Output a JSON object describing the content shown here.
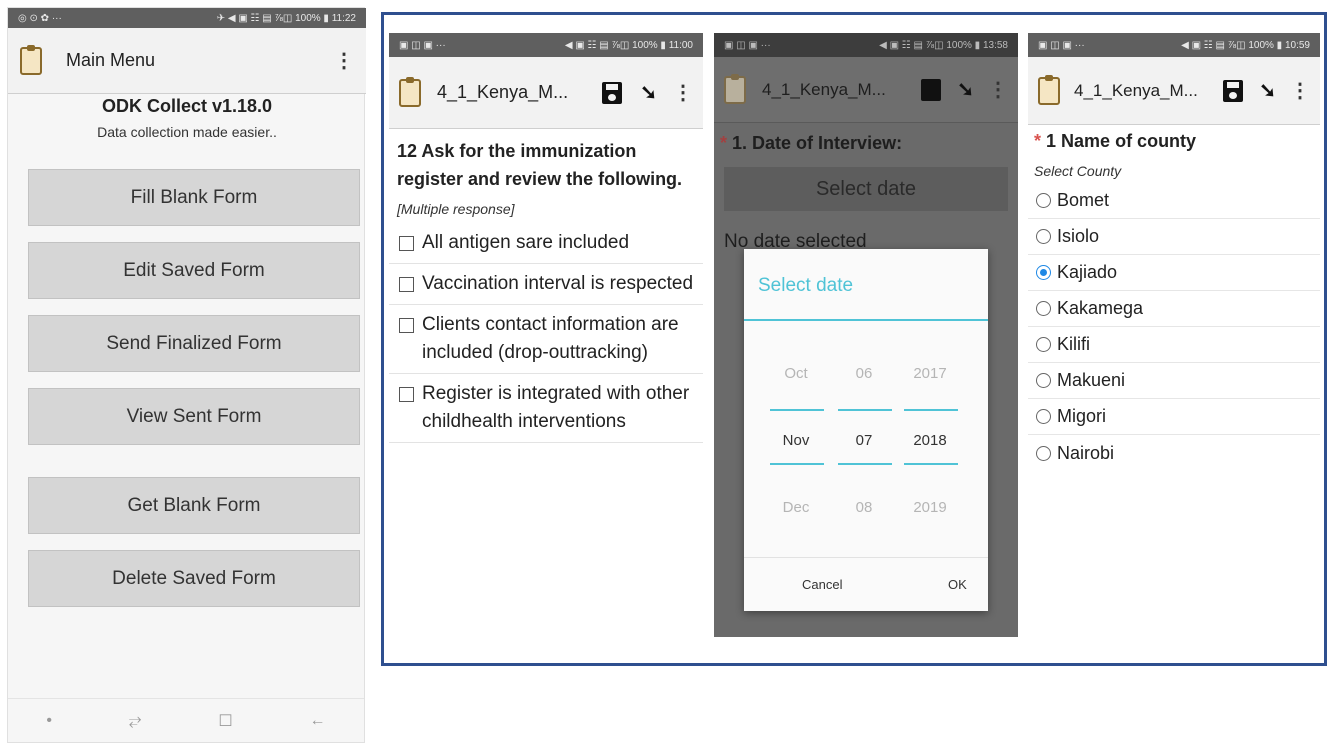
{
  "screen1": {
    "status_left": "◎ ⊙ ✿ ···",
    "status_right": "✈ ◀ ▣ ☷ ▤ ⅞◫ 100% ▮ 11:22",
    "title": "Main Menu",
    "app_name": "ODK Collect v1.18.0",
    "tagline": "Data collection made easier..",
    "buttons": [
      "Fill Blank Form",
      "Edit Saved Form",
      "Send Finalized Form",
      "View Sent Form",
      "Get Blank Form",
      "Delete Saved Form"
    ],
    "nav": {
      "dot": "•",
      "recent": "⥂",
      "home": "☐",
      "back": "←"
    }
  },
  "screen2": {
    "status_left": "▣ ◫ ▣ ···",
    "status_right": "◀ ▣ ☷ ▤ ⅞◫ 100% ▮ 11:00",
    "title": "4_1_Kenya_M...",
    "question": "12 Ask for the immunization register and review the following.",
    "hint": "[Multiple response]",
    "options": [
      "All antigen sare included",
      "Vaccination interval is respected",
      "Clients contact information are included (drop-outtracking)",
      "Register is integrated with other childhealth interventions"
    ]
  },
  "screen3": {
    "status_left": "▣ ◫ ▣ ···",
    "status_right": "◀ ▣ ☷ ▤ ⅞◫ 100% ▮ 13:58",
    "title": "4_1_Kenya_M...",
    "required_mark": "*",
    "question": "1. Date of Interview:",
    "select_button": "Select date",
    "no_date": "No date selected",
    "dialog": {
      "title": "Select date",
      "months": [
        "Oct",
        "Nov",
        "Dec"
      ],
      "days": [
        "06",
        "07",
        "08"
      ],
      "years": [
        "2017",
        "2018",
        "2019"
      ],
      "cancel": "Cancel",
      "ok": "OK"
    }
  },
  "screen4": {
    "status_left": "▣ ◫ ▣ ···",
    "status_right": "◀ ▣ ☷ ▤ ⅞◫ 100% ▮ 10:59",
    "title": "4_1_Kenya_M...",
    "required_mark": "*",
    "question": "1 Name of county",
    "hint": "Select County",
    "options": [
      "Bomet",
      "Isiolo",
      "Kajiado",
      "Kakamega",
      "Kilifi",
      "Makueni",
      "Migori",
      "Nairobi"
    ],
    "selected": "Kajiado"
  },
  "colors": {
    "frame": "#2f4f8f",
    "accent": "#4fc3d6",
    "radio_selected": "#1e88e5",
    "required": "#d9534f"
  }
}
